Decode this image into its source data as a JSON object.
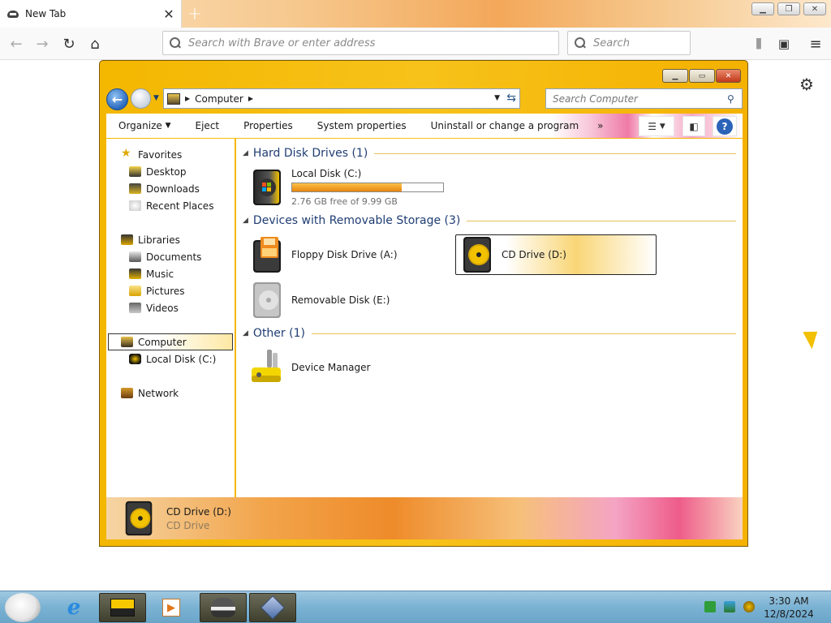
{
  "browser": {
    "tab_title": "New Tab",
    "url_placeholder": "Search with Brave or enter address",
    "search_placeholder": "Search"
  },
  "explorer": {
    "address": {
      "crumb": "Computer"
    },
    "search_placeholder": "Search Computer",
    "toolbar": {
      "organize": "Organize",
      "eject": "Eject",
      "properties": "Properties",
      "system_properties": "System properties",
      "uninstall": "Uninstall or change a program",
      "more": "»"
    },
    "nav": {
      "favorites": "Favorites",
      "desktop": "Desktop",
      "downloads": "Downloads",
      "recent_places": "Recent Places",
      "libraries": "Libraries",
      "documents": "Documents",
      "music": "Music",
      "pictures": "Pictures",
      "videos": "Videos",
      "computer": "Computer",
      "local_disk": "Local Disk (C:)",
      "network": "Network"
    },
    "groups": {
      "hard_disks": "Hard Disk Drives (1)",
      "removable": "Devices with Removable Storage (3)",
      "other": "Other (1)"
    },
    "items": {
      "local_disk": {
        "name": "Local Disk (C:)",
        "free_text": "2.76 GB free of 9.99 GB",
        "used_fraction": 0.724
      },
      "floppy": {
        "name": "Floppy Disk Drive (A:)"
      },
      "cd": {
        "name": "CD Drive (D:)"
      },
      "removable": {
        "name": "Removable Disk (E:)"
      },
      "device_manager": {
        "name": "Device Manager"
      }
    },
    "details": {
      "name": "CD Drive (D:)",
      "type": "CD Drive"
    }
  },
  "taskbar": {
    "time": "3:30 AM",
    "date": "12/8/2024"
  },
  "colors": {
    "theme_yellow": "#f4b700",
    "group_heading": "#1f3d73",
    "usage_fill": "#e8860d"
  }
}
